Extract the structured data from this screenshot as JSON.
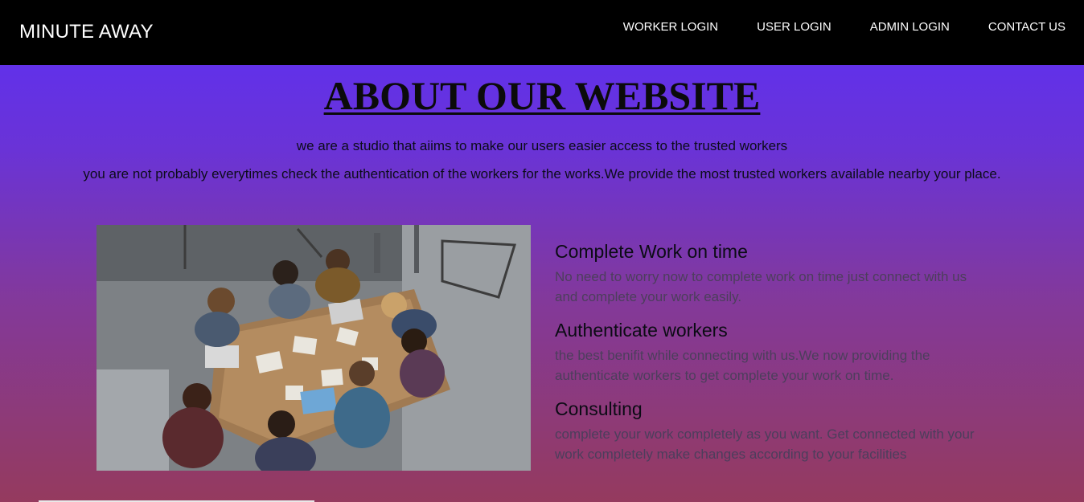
{
  "header": {
    "brand": "MINUTE AWAY",
    "nav": [
      {
        "label": "WORKER LOGIN"
      },
      {
        "label": "USER LOGIN"
      },
      {
        "label": "ADMIN LOGIN"
      },
      {
        "label": "CONTACT US"
      }
    ]
  },
  "about": {
    "heading": "ABOUT OUR WEBSITE",
    "line1": "we are a studio that aiims to make our users easier access to the trusted workers",
    "line2": "you are not probably everytimes check the authentication of the workers for the works.We provide the most trusted workers available nearby your place."
  },
  "features": [
    {
      "title": "Complete Work on time",
      "description": "No need to worry now to complete work on time just connect with us and complete your work easily."
    },
    {
      "title": "Authenticate workers",
      "description": "the best benifit while connecting with us.We now providing the authenticate workers to get complete your work on time."
    },
    {
      "title": "Consulting",
      "description": "complete your work completely as you want. Get connected with your work completely make changes according to your facilities"
    }
  ],
  "colors": {
    "navbar": "#000000",
    "gradient_top": "#5b2ff7",
    "gradient_bottom": "#953a5e",
    "heading": "#0b0b0b",
    "description": "#4c3e5c"
  }
}
